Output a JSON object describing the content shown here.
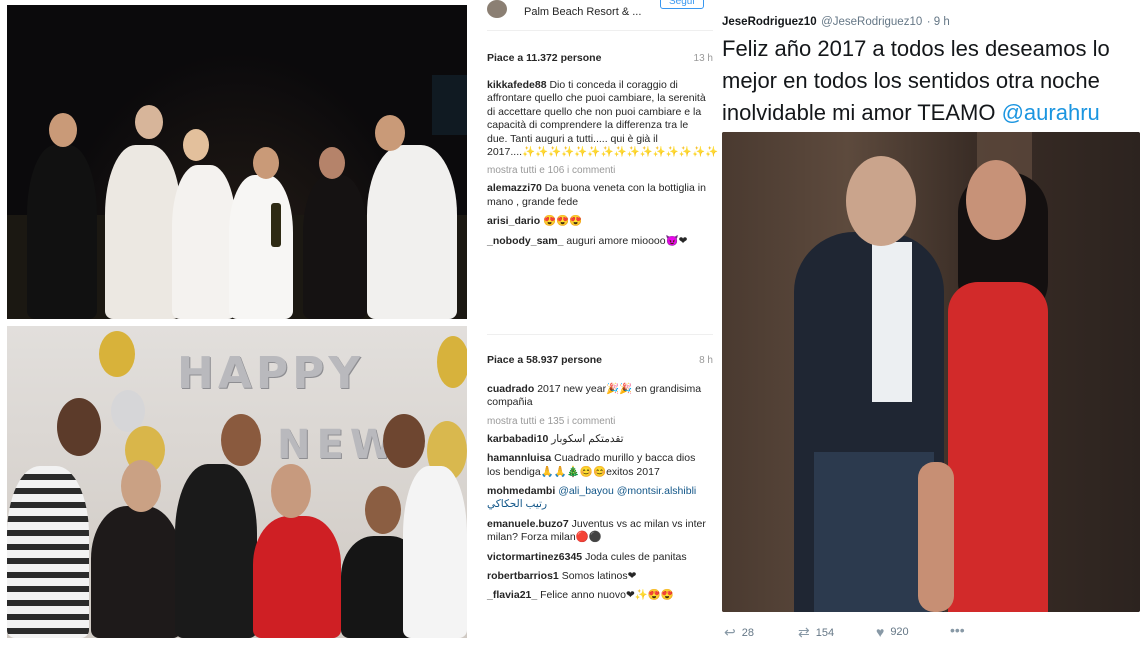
{
  "instagram_top": {
    "location": "Palm Beach Resort & ...",
    "follow_label": "Segui",
    "likes": "Piace a 11.372 persone",
    "time": "13 h",
    "comments": [
      {
        "user": "kikkafede88",
        "text": "Dio ti conceda il coraggio di affrontare quello che puoi cambiare, la serenità di accettare quello che non puoi cambiare e la capacità di comprendere la differenza tra le due. Tanti auguri a tutti..... qui è già il 2017....✨✨✨✨✨✨✨✨✨✨✨✨✨✨✨✨"
      },
      {
        "user": "alemazzi70",
        "text": "Da buona veneta con la bottiglia in mano , grande fede"
      },
      {
        "user": "arisi_dario",
        "text": "😍😍😍"
      },
      {
        "user": "_nobody_sam_",
        "text": "auguri amore mioooo😈❤"
      }
    ],
    "more": "mostra tutti e 106 i commenti"
  },
  "instagram_bottom": {
    "likes": "Piace a 58.937 persone",
    "time": "8 h",
    "comments": [
      {
        "user": "cuadrado",
        "text": "2017 new year🎉🎉 en grandisima compañia"
      },
      {
        "user": "karbabadi10",
        "text": "تقدمتكم اسكوبار"
      },
      {
        "user": "hamannluisa",
        "text": "Cuadrado murillo y bacca dios los bendiga🙏🙏🎄😊😊exitos 2017"
      },
      {
        "user": "mohmedambi",
        "text": "@ali_bayou @montsir.alshibli رتيب الحكاكي"
      },
      {
        "user": "emanuele.buzo7",
        "text": "Juventus vs ac milan vs inter milan? Forza milan🔴⚫"
      },
      {
        "user": "victormartinez6345",
        "text": "Joda cules de panitas"
      },
      {
        "user": "robertbarrios1",
        "text": "Somos latinos❤"
      },
      {
        "user": "_flavia21_",
        "text": "Felice anno nuovo❤✨😍😍"
      }
    ],
    "more": "mostra tutti e 135 i commenti"
  },
  "tweet": {
    "name": "JeseRodriguez10",
    "handle": "@JeseRodriguez10",
    "time": "· 9 h",
    "lines": [
      "Feliz año 2017 a todos les deseamos lo",
      "mejor en todos los sentidos otra noche",
      "inolvidable mi amor TEAMO"
    ],
    "mention": "@aurahru",
    "replies": "28",
    "retweets": "154",
    "likes": "920"
  },
  "balloon_letters": [
    "H",
    "A",
    "P",
    "P",
    "Y"
  ],
  "balloon_letters_2": [
    "N",
    "E",
    "W"
  ]
}
